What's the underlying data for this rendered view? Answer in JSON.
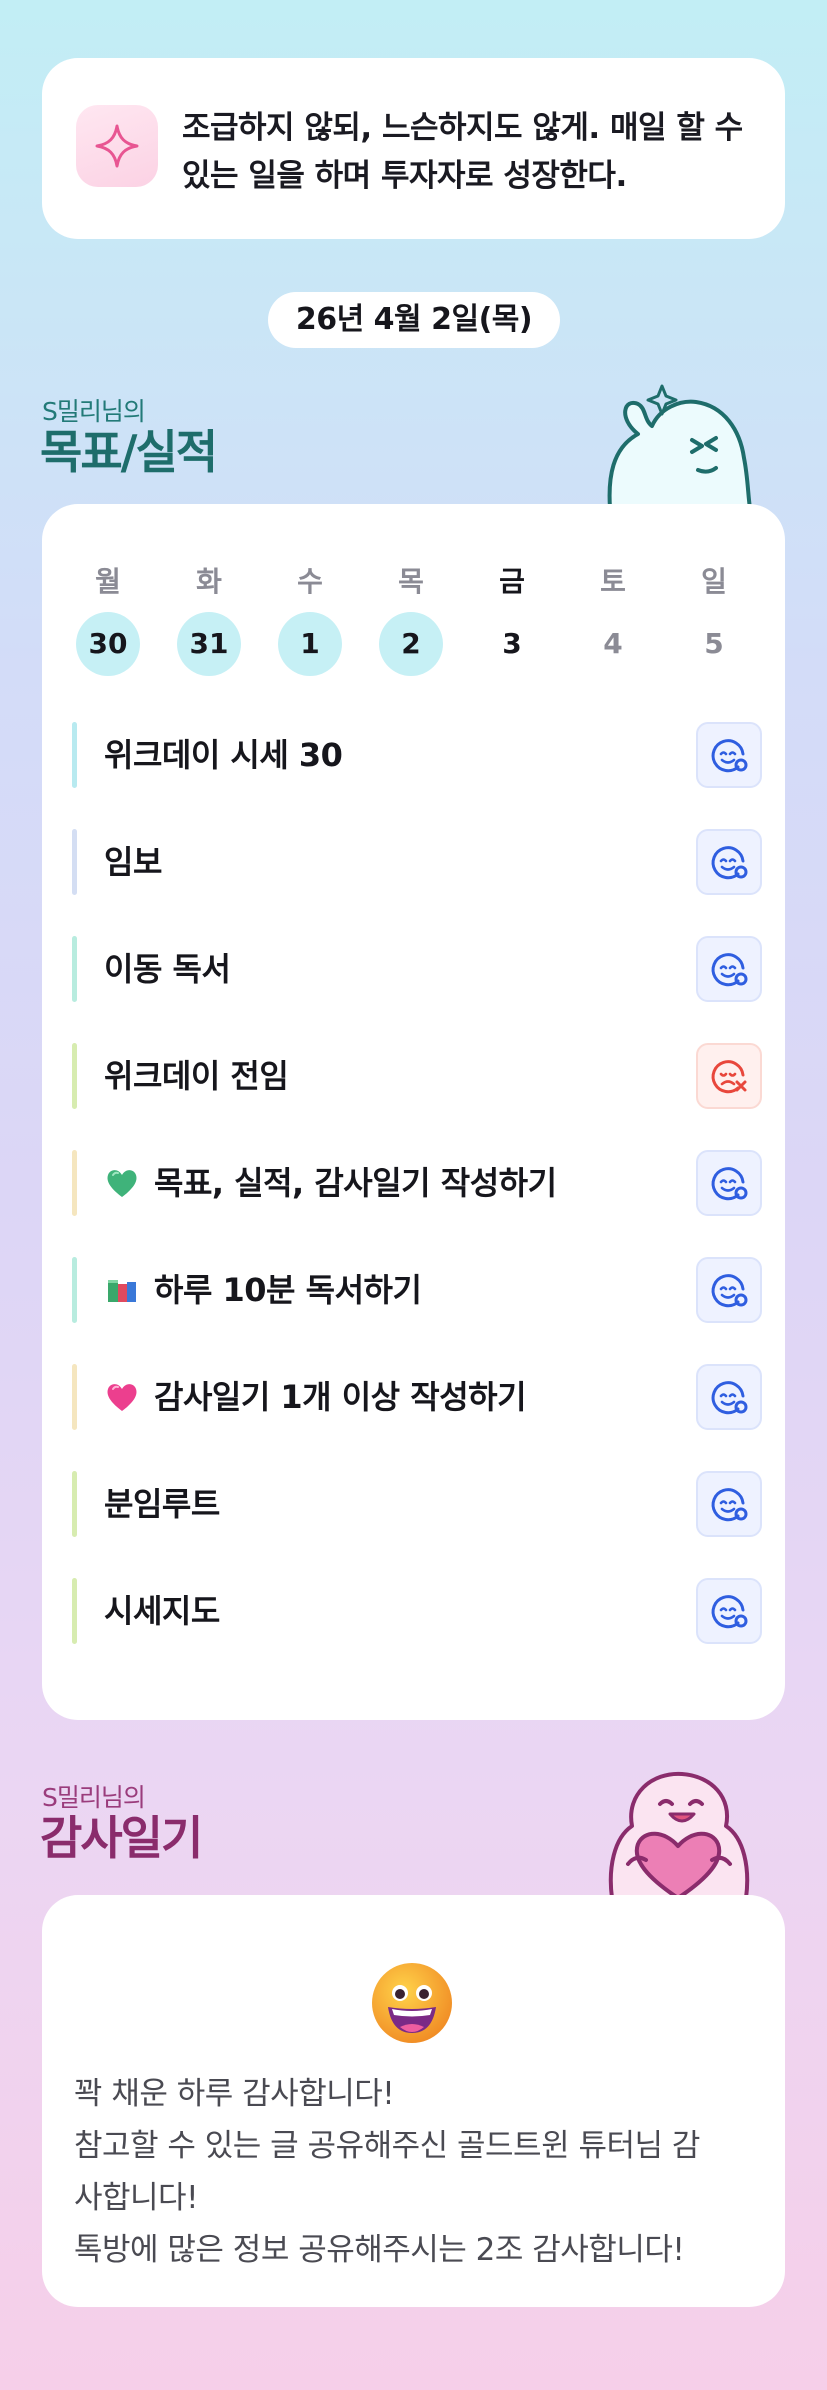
{
  "motto": {
    "icon": "sparkle-icon",
    "text": "조급하지 않되, 느슨하지도 않게. 매일 할 수 있는 일을 하며 투자자로 성장한다."
  },
  "date": "26년 4월 2일(목)",
  "goals_section": {
    "subtitle": "S밀리님의",
    "title": "목표/실적"
  },
  "week": {
    "days": [
      {
        "label": "월",
        "num": "30",
        "state": "done"
      },
      {
        "label": "화",
        "num": "31",
        "state": "done"
      },
      {
        "label": "수",
        "num": "1",
        "state": "done"
      },
      {
        "label": "목",
        "num": "2",
        "state": "done"
      },
      {
        "label": "금",
        "num": "3",
        "state": "today"
      },
      {
        "label": "토",
        "num": "4",
        "state": "future"
      },
      {
        "label": "일",
        "num": "5",
        "state": "future"
      }
    ]
  },
  "tasks": [
    {
      "label": "위크데이 시세 30",
      "bar_color": "#b8eaf0",
      "emoji": "",
      "status": "ok"
    },
    {
      "label": "임보",
      "bar_color": "#d4def3",
      "emoji": "",
      "status": "ok"
    },
    {
      "label": "이동 독서",
      "bar_color": "#b8ecdf",
      "emoji": "",
      "status": "ok"
    },
    {
      "label": "위크데이 전임",
      "bar_color": "#d7ecb0",
      "emoji": "",
      "status": "fail"
    },
    {
      "label": "목표, 실적, 감사일기 작성하기",
      "bar_color": "#f5e6bf",
      "emoji": "green-heart-icon",
      "status": "ok"
    },
    {
      "label": "하루 10분 독서하기",
      "bar_color": "#b8ecdf",
      "emoji": "books-icon",
      "status": "ok"
    },
    {
      "label": "감사일기 1개 이상 작성하기",
      "bar_color": "#f5e6bf",
      "emoji": "pink-heart-icon",
      "status": "ok"
    },
    {
      "label": "분임루트",
      "bar_color": "#d7ecb0",
      "emoji": "",
      "status": "ok"
    },
    {
      "label": "시세지도",
      "bar_color": "#d7ecb0",
      "emoji": "",
      "status": "ok"
    }
  ],
  "thanks_section": {
    "subtitle": "S밀리님의",
    "title": "감사일기"
  },
  "thanks": {
    "emoji": "grinning-face-icon",
    "lines": [
      "꽉 채운 하루 감사합니다!",
      "참고할 수 있는 글 공유해주신 골드트윈 튜터님 감",
      "사합니다!",
      "톡방에 많은 정보 공유해주시는 2조 감사합니다!"
    ]
  },
  "colors": {
    "done_day": "#c6f0f5",
    "ok_icon": "#2f5ee0",
    "fail_icon": "#e8473c",
    "goal_title": "#1e6d6b",
    "thanks_title": "#8a2c6c"
  }
}
